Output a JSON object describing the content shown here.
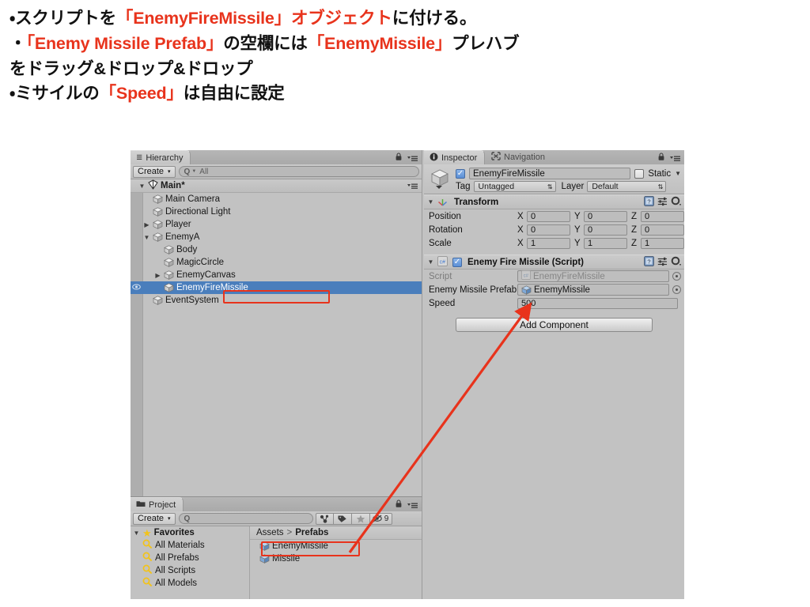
{
  "instructions": {
    "line1_a": "・スクリプトを",
    "line1_b": "「EnemyFireMissile」オブジェクト",
    "line1_c": "に付ける。",
    "line2_a": "・",
    "line2_b": "「Enemy Missile Prefab」",
    "line2_c": "の空欄には",
    "line2_d": "「EnemyMissile」",
    "line2_e": "プレハブ",
    "line3": "をドラッグ&ドロップ&ドロップ",
    "line4_a": "・ミサイルの",
    "line4_b": "「Speed」",
    "line4_c": "は自由に設定",
    "highlight_color": "#e8331c"
  },
  "hierarchy": {
    "tab_label": "Hierarchy",
    "tab_icon": "hierarchy-icon",
    "create_label": "Create",
    "create_arrow": "▾",
    "search_icon": "Q",
    "search_value": "All",
    "scene_name": "Main*",
    "scene_expand": "▼",
    "items": [
      {
        "label": "Main Camera",
        "depth": 1,
        "expand": "",
        "selected": false
      },
      {
        "label": "Directional Light",
        "depth": 1,
        "expand": "",
        "selected": false
      },
      {
        "label": "Player",
        "depth": 1,
        "expand": "▶",
        "selected": false
      },
      {
        "label": "EnemyA",
        "depth": 1,
        "expand": "▼",
        "selected": false
      },
      {
        "label": "Body",
        "depth": 2,
        "expand": "",
        "selected": false
      },
      {
        "label": "MagicCircle",
        "depth": 2,
        "expand": "",
        "selected": false
      },
      {
        "label": "EnemyCanvas",
        "depth": 2,
        "expand": "▶",
        "selected": false
      },
      {
        "label": "EnemyFireMissile",
        "depth": 2,
        "expand": "",
        "selected": true
      },
      {
        "label": "EventSystem",
        "depth": 1,
        "expand": "",
        "selected": false
      }
    ],
    "selection_color": "#4a7ebc"
  },
  "inspector": {
    "tabs": [
      {
        "label": "Inspector",
        "icon": "info-icon",
        "active": true
      },
      {
        "label": "Navigation",
        "icon": "navigation-icon",
        "active": false
      }
    ],
    "lock_icon": "lock-icon",
    "menu_icon": "menu-icon",
    "gameobject": {
      "icon": "gameobject-cube-icon",
      "enabled_checkbox": true,
      "name": "EnemyFireMissile",
      "static_label": "Static",
      "static_checked": false,
      "static_dropdown_arrow": "▼",
      "tag_label": "Tag",
      "tag_value": "Untagged",
      "layer_label": "Layer",
      "layer_value": "Default"
    },
    "components": [
      {
        "title": "Transform",
        "icon": "transform-axis-icon",
        "expand": "▼",
        "has_enable_checkbox": false,
        "help_icon": "help-book-icon",
        "preset_icon": "preset-icon",
        "gear_icon": "gear-icon",
        "rows": [
          {
            "name": "Position",
            "type": "vector3",
            "x": "0",
            "y": "0",
            "z": "0"
          },
          {
            "name": "Rotation",
            "type": "vector3",
            "x": "0",
            "y": "0",
            "z": "0"
          },
          {
            "name": "Scale",
            "type": "vector3",
            "x": "1",
            "y": "1",
            "z": "1"
          }
        ]
      },
      {
        "title": "Enemy Fire Missile (Script)",
        "icon": "csharp-script-icon",
        "expand": "▼",
        "has_enable_checkbox": true,
        "enabled": true,
        "help_icon": "help-book-icon",
        "preset_icon": "preset-icon",
        "gear_icon": "gear-icon",
        "rows": [
          {
            "name": "Script",
            "type": "object-dim",
            "value": "EnemyFireMissile",
            "icon": "csharp-script-icon"
          },
          {
            "name": "Enemy Missile Prefab",
            "type": "object",
            "value": "EnemyMissile",
            "icon": "prefab-cube-icon"
          },
          {
            "name": "Speed",
            "type": "number",
            "value": "500"
          }
        ]
      }
    ],
    "axis_labels": {
      "x": "X",
      "y": "Y",
      "z": "Z"
    },
    "add_component_label": "Add Component"
  },
  "project": {
    "tab_label": "Project",
    "tab_icon": "folder-icon",
    "lock_icon": "lock-icon",
    "menu_icon": "menu-icon",
    "create_label": "Create",
    "create_arrow": "▾",
    "search_icon": "Q",
    "search_value": "",
    "filter_buttons": [
      {
        "icon": "asset-filter-icon",
        "label": ""
      },
      {
        "icon": "label-filter-icon",
        "label": ""
      },
      {
        "icon": "star-filter-icon",
        "label": ""
      },
      {
        "icon": "visibility-icon",
        "label": "9"
      }
    ],
    "favorites": {
      "expand": "▼",
      "star_icon": "star-icon",
      "label": "Favorites",
      "items": [
        {
          "icon": "search-icon",
          "label": "All Materials"
        },
        {
          "icon": "search-icon",
          "label": "All Prefabs"
        },
        {
          "icon": "search-icon",
          "label": "All Scripts"
        },
        {
          "icon": "search-icon",
          "label": "All Models"
        }
      ]
    },
    "breadcrumb": {
      "root": "Assets",
      "separator": ">",
      "current": "Prefabs"
    },
    "assets": [
      {
        "icon": "prefab-cube-icon",
        "label": "EnemyMissile",
        "highlighted": true
      },
      {
        "icon": "prefab-cube-icon",
        "label": "Missile",
        "highlighted": false
      }
    ]
  },
  "annotations": {
    "color": "#e8331c",
    "boxes": [
      {
        "name": "hierarchy-enemyfiremissile-box"
      },
      {
        "name": "prefab-enemymissile-box"
      }
    ],
    "arrow": {
      "name": "drag-drop-arrow",
      "from": "prefab-enemymissile-box",
      "to": "enemy-missile-prefab-field"
    }
  }
}
